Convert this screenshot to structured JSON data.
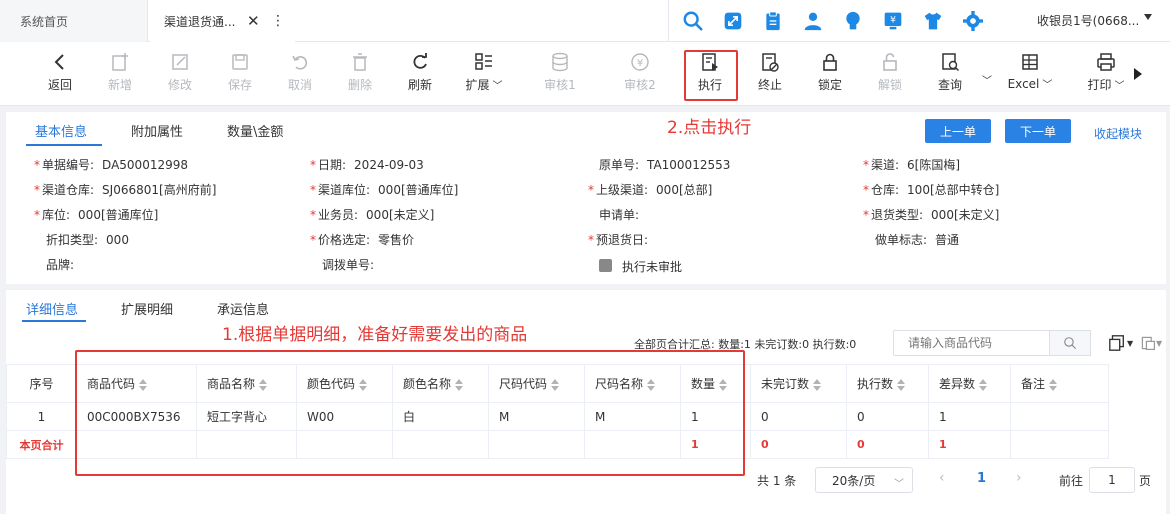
{
  "tabs": {
    "home": "系统首页",
    "active": "渠道退货通..."
  },
  "user": {
    "name": "收银员1号(0668..."
  },
  "toolbar": {
    "buttons": [
      {
        "key": "back",
        "label": "返回",
        "disabled": false
      },
      {
        "key": "add",
        "label": "新增",
        "disabled": true
      },
      {
        "key": "edit",
        "label": "修改",
        "disabled": true
      },
      {
        "key": "save",
        "label": "保存",
        "disabled": true
      },
      {
        "key": "cancel",
        "label": "取消",
        "disabled": true
      },
      {
        "key": "delete",
        "label": "删除",
        "disabled": true
      },
      {
        "key": "refresh",
        "label": "刷新",
        "disabled": false
      },
      {
        "key": "extend",
        "label": "扩展",
        "disabled": false
      },
      {
        "key": "audit1",
        "label": "审核1",
        "disabled": true
      },
      {
        "key": "audit2",
        "label": "审核2",
        "disabled": true
      },
      {
        "key": "execute",
        "label": "执行",
        "disabled": false
      },
      {
        "key": "stop",
        "label": "终止",
        "disabled": false
      },
      {
        "key": "lock",
        "label": "锁定",
        "disabled": false
      },
      {
        "key": "unlock",
        "label": "解锁",
        "disabled": true
      },
      {
        "key": "query",
        "label": "查询",
        "disabled": false
      },
      {
        "key": "excel",
        "label": "Excel",
        "disabled": false
      },
      {
        "key": "print",
        "label": "打印",
        "disabled": false
      }
    ]
  },
  "annotations": {
    "step2": "2.点击执行",
    "step1": "1.根据单据明细，准备好需要发出的商品"
  },
  "form": {
    "tabs": [
      "基本信息",
      "附加属性",
      "数量\\金额"
    ],
    "prev_label": "上一单",
    "next_label": "下一单",
    "collapse_label": "收起模块",
    "fields": {
      "doc_no": {
        "label": "单据编号:",
        "value": "DA500012998"
      },
      "date": {
        "label": "日期:",
        "value": "2024-09-03"
      },
      "orig_no": {
        "label": "原单号:",
        "value": "TA100012553"
      },
      "channel": {
        "label": "渠道:",
        "value": "6[陈国梅]"
      },
      "channel_wh": {
        "label": "渠道仓库:",
        "value": "SJ066801[高州府前]"
      },
      "channel_loc": {
        "label": "渠道库位:",
        "value": "000[普通库位]"
      },
      "parent_channel": {
        "label": "上级渠道:",
        "value": "000[总部]"
      },
      "warehouse": {
        "label": "仓库:",
        "value": "100[总部中转仓]"
      },
      "location": {
        "label": "库位:",
        "value": "000[普通库位]"
      },
      "salesman": {
        "label": "业务员:",
        "value": "000[未定义]"
      },
      "apply_no": {
        "label": "申请单:",
        "value": ""
      },
      "return_type": {
        "label": "退货类型:",
        "value": "000[未定义]"
      },
      "discount_type": {
        "label": "折扣类型:",
        "value": "000"
      },
      "price_select": {
        "label": "价格选定:",
        "value": "零售价"
      },
      "pre_ship_date": {
        "label": "预退货日:",
        "value": ""
      },
      "doc_flag": {
        "label": "做单标志:",
        "value": "普通"
      },
      "brand": {
        "label": "品牌:",
        "value": ""
      },
      "transfer_no": {
        "label": "调拨单号:",
        "value": ""
      },
      "exec_unapproved": {
        "label": "执行未审批"
      }
    }
  },
  "detail": {
    "tabs": [
      "详细信息",
      "扩展明细",
      "承运信息"
    ],
    "summary": "全部页合计汇总:  数量:1 未完订数:0 执行数:0",
    "search_placeholder": "请输入商品代码",
    "columns": [
      "序号",
      "商品代码",
      "商品名称",
      "颜色代码",
      "颜色名称",
      "尺码代码",
      "尺码名称",
      "数量",
      "未完订数",
      "执行数",
      "差异数",
      "备注"
    ],
    "rows": [
      [
        "1",
        "00C000BX7536",
        "短工字背心",
        "W00",
        "白",
        "M",
        "M",
        "1",
        "0",
        "0",
        "1",
        ""
      ]
    ],
    "total_label": "本页合计",
    "totals": {
      "qty": "1",
      "pending": "0",
      "executed": "0",
      "diff": "1"
    }
  },
  "pagination": {
    "total": "共 1 条",
    "page_size": "20条/页",
    "current": "1",
    "goto_prefix": "前往",
    "goto_value": "1",
    "goto_suffix": "页"
  },
  "colors": {
    "accent": "#2a82e4",
    "annotation": "#e53935",
    "icon_blue": "#1e88e5"
  }
}
